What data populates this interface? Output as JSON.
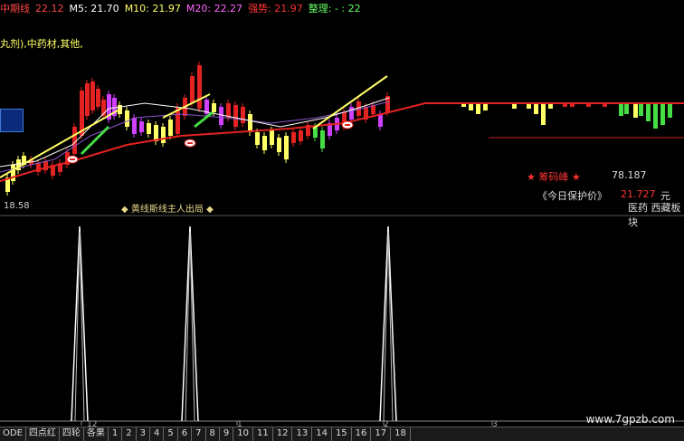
{
  "ma_bar": {
    "title": "中期线",
    "title_value": "22.12",
    "m5": "M5: 21.70",
    "m10": "M10: 21.97",
    "m20": "M20: 22.27",
    "strong": "强势: 21.97",
    "adjust": "整理: - : 22"
  },
  "category_line": "丸剂),中药材,其他,",
  "low_label": "18.58",
  "signal_title": "黄线斯线主人出局",
  "info": {
    "chip_peak_label": "筹码峰",
    "chip_peak_value": "78.187",
    "protect_label": "《今日保护价》",
    "protect_value": "21.727",
    "protect_unit": "元",
    "sector": "医药  西藏板块"
  },
  "x_axis": {
    "label_12": "12",
    "label_1": "1",
    "label_2": "2",
    "label_3": "3"
  },
  "watermark": "www.7gpzb.com",
  "tabs": [
    "ODE",
    "四点红",
    "四轮",
    "各果",
    "1",
    "2",
    "3",
    "4",
    "5",
    "6",
    "7",
    "8",
    "9",
    "10",
    "11",
    "12",
    "13",
    "14",
    "15",
    "16",
    "17",
    "18"
  ],
  "colors": {
    "up": "#e32222",
    "down": "#00d0d0",
    "yellow": "#ffff66",
    "magenta": "#d040ff",
    "green": "#44dd44"
  }
}
